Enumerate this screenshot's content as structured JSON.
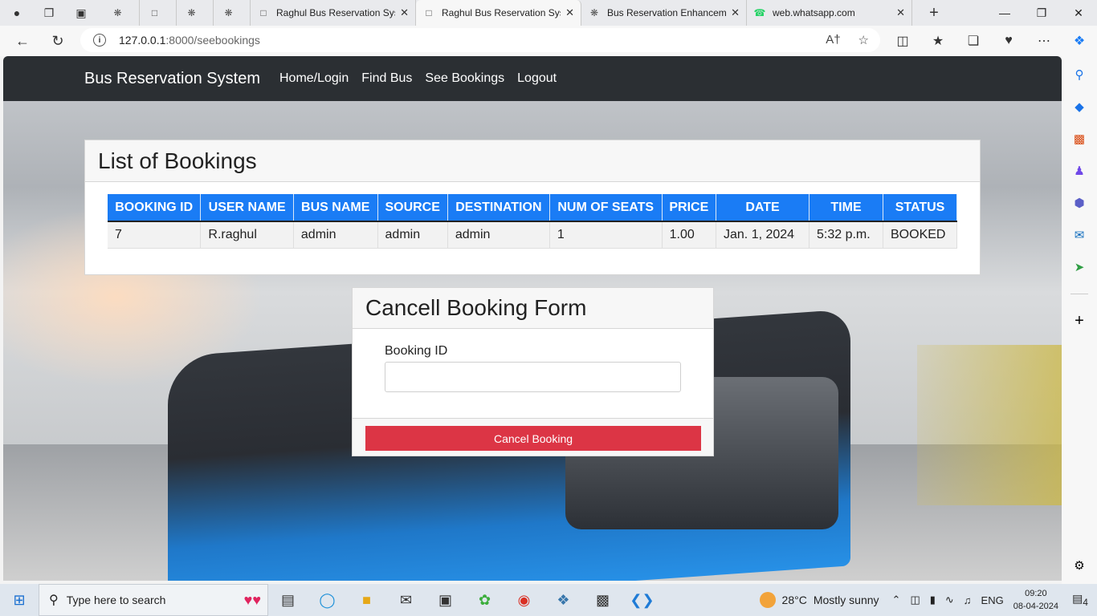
{
  "browser": {
    "tabs": [
      {
        "label": "",
        "kind": "profile"
      },
      {
        "label": "",
        "kind": "workspaces"
      },
      {
        "label": "",
        "kind": "tab-actions"
      },
      {
        "label": "",
        "kind": "chatgpt"
      },
      {
        "label": "",
        "kind": "page"
      },
      {
        "label": "",
        "kind": "chatgpt"
      },
      {
        "label": "",
        "kind": "chatgpt"
      },
      {
        "label": "Raghul Bus Reservation Sys"
      },
      {
        "label": "Raghul Bus Reservation Sys",
        "active": true
      },
      {
        "label": "Bus Reservation Enhancem"
      },
      {
        "label": "web.whatsapp.com"
      }
    ],
    "url_host": "127.0.0.1",
    "url_path": ":8000/seebookings"
  },
  "site": {
    "brand": "Bus Reservation System",
    "nav": [
      "Home/Login",
      "Find Bus",
      "See Bookings",
      "Logout"
    ]
  },
  "bookings": {
    "title": "List of Bookings",
    "columns": [
      "BOOKING ID",
      "USER NAME",
      "BUS NAME",
      "SOURCE",
      "DESTINATION",
      "NUM OF SEATS",
      "PRICE",
      "DATE",
      "TIME",
      "STATUS"
    ],
    "rows": [
      [
        "7",
        "R.raghul",
        "admin",
        "admin",
        "admin",
        "1",
        "1.00",
        "Jan. 1, 2024",
        "5:32 p.m.",
        "BOOKED"
      ]
    ]
  },
  "cancel_form": {
    "title": "Cancell Booking Form",
    "field_label": "Booking ID",
    "field_value": "",
    "button_label": "Cancel Booking"
  },
  "taskbar": {
    "search_placeholder": "Type here to search",
    "weather_temp": "28°C",
    "weather_text": "Mostly sunny",
    "language": "ENG",
    "time": "09:20",
    "date": "08-04-2024",
    "notifications": "4"
  },
  "colors": {
    "navbar": "#2b2f33",
    "table_header": "#1a7cf5",
    "danger": "#dc3545"
  }
}
